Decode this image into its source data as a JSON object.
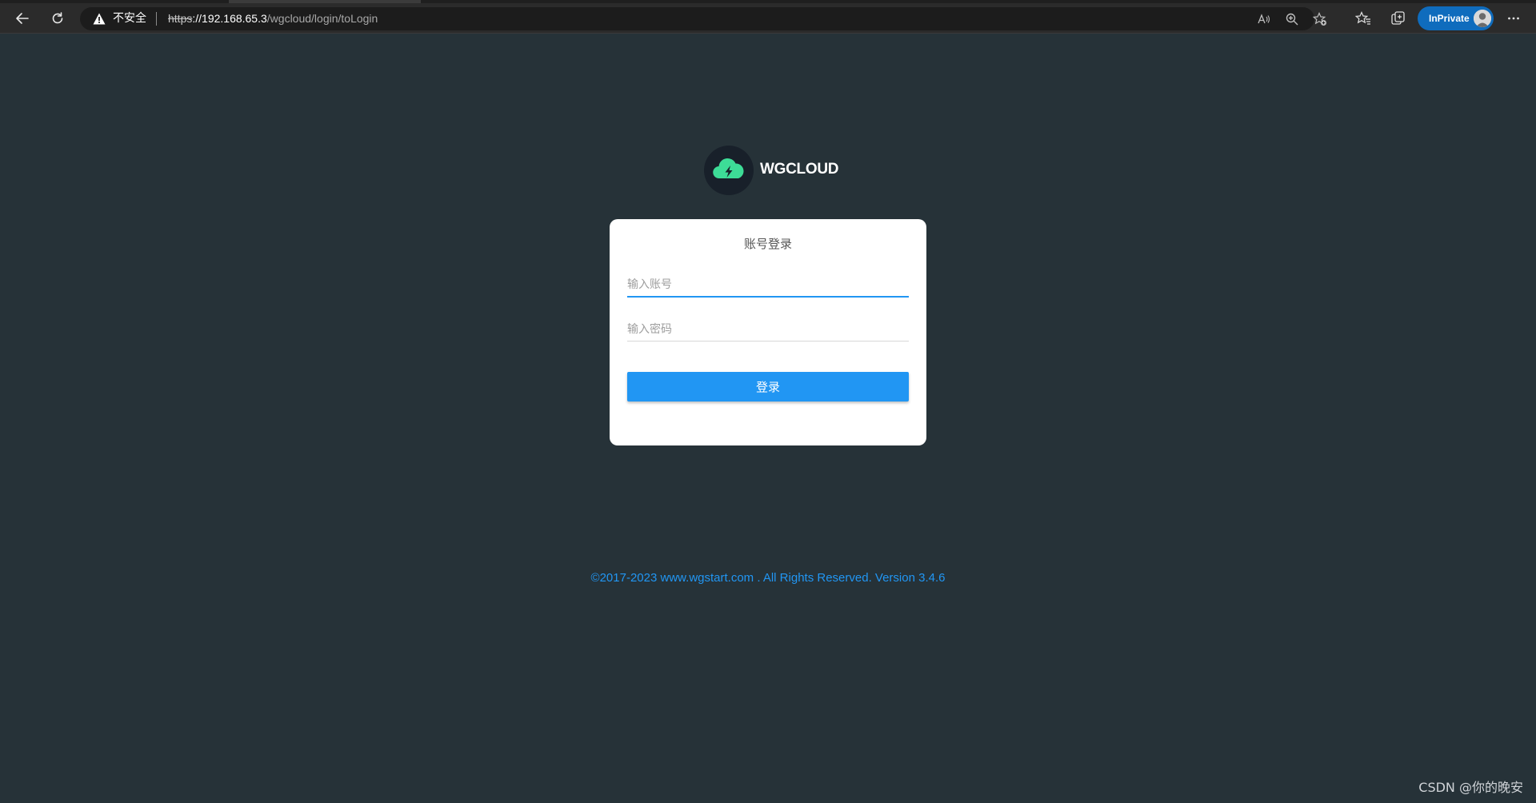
{
  "browser": {
    "security_label": "不安全",
    "url_scheme": "https",
    "url_host": "://192.168.65.3",
    "url_path": "/wgcloud/login/toLogin",
    "inprivate_label": "InPrivate"
  },
  "page": {
    "brand": "WGCLOUD",
    "login_title": "账号登录",
    "username_placeholder": "输入账号",
    "password_placeholder": "输入密码",
    "login_button": "登录",
    "footer": "©2017-2023 www.wgstart.com . All Rights Reserved. Version 3.4.6"
  },
  "watermark": "CSDN @你的晚安",
  "colors": {
    "background": "#263238",
    "accent": "#2196f3",
    "logo_cloud": "#3ddc97",
    "inprivate": "#0f6cbd"
  }
}
